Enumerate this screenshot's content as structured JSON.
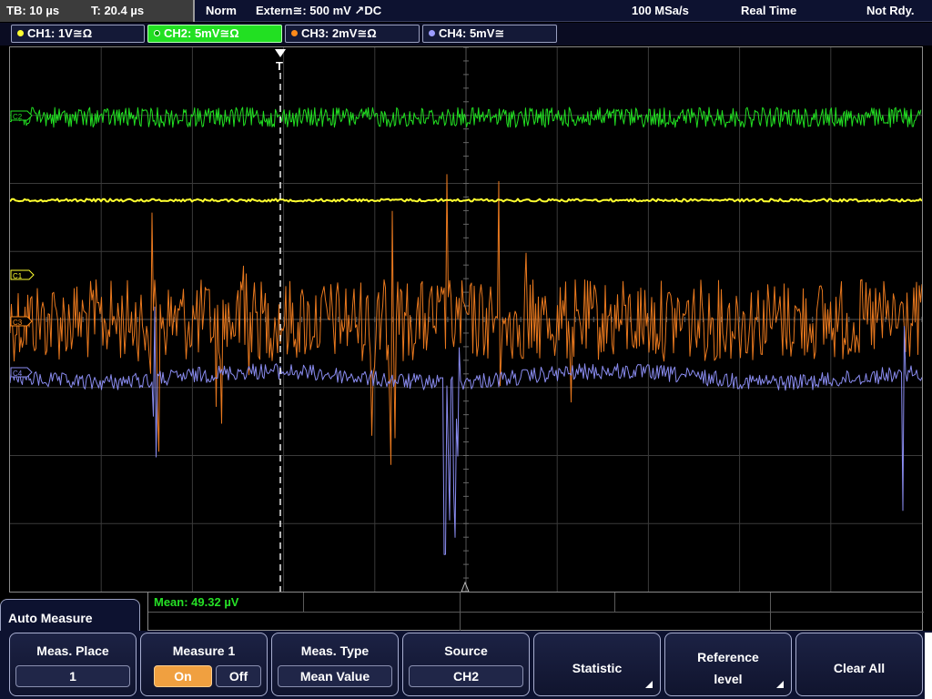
{
  "status": {
    "timebase": "TB: 10 µs",
    "trigger_time": "T: 20.4 µs",
    "trigger_mode": "Norm",
    "trigger_source": "Extern≅: 500 mV ↗DC",
    "sample_rate": "100 MSa/s",
    "acq_mode": "Real Time",
    "state": "Not Rdy."
  },
  "channels": [
    {
      "label": "CH1: 1V≅Ω",
      "color": "#ffff30",
      "active": false
    },
    {
      "label": "CH2: 5mV≅Ω",
      "color": "#22e022",
      "active": true
    },
    {
      "label": "CH3: 2mV≅Ω",
      "color": "#ff8a1a",
      "active": false
    },
    {
      "label": "CH4: 5mV≅",
      "color": "#9c9cff",
      "active": false
    }
  ],
  "markers": {
    "ch2": "C2",
    "ch1": "C1",
    "ch3": "C3",
    "ch4": "C4",
    "trigger": "T"
  },
  "measurement": {
    "readout": "Mean: 49.32 µV"
  },
  "menu": {
    "title": "Auto Measure",
    "keys": [
      {
        "label": "Meas. Place",
        "value": "1"
      },
      {
        "label": "Measure 1",
        "on": "On",
        "off": "Off"
      },
      {
        "label": "Meas. Type",
        "value": "Mean Value"
      },
      {
        "label": "Source",
        "value": "CH2"
      },
      {
        "label": "Statistic"
      },
      {
        "label1": "Reference",
        "label2": "level"
      },
      {
        "label": "Clear All"
      }
    ]
  },
  "colors": {
    "ch1": "#ffff30",
    "ch2": "#22e022",
    "ch3": "#e8781e",
    "ch4": "#8a8cf0",
    "grid": "#3a3a3a",
    "axis": "#8a8a8a"
  }
}
